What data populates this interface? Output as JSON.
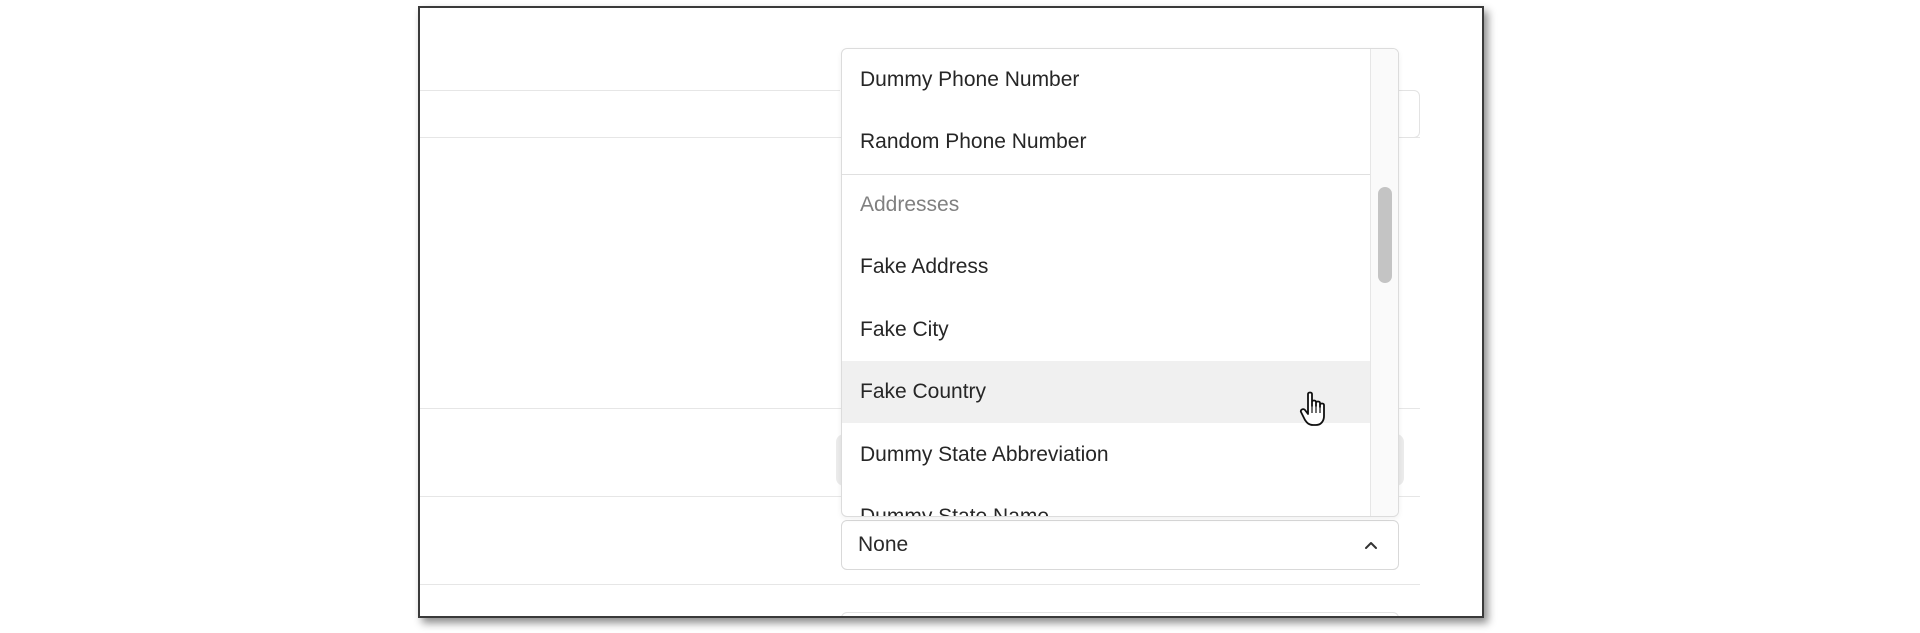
{
  "dropdown": {
    "items": [
      {
        "label": "Dummy Phone Number",
        "type": "option"
      },
      {
        "label": "Random Phone Number",
        "type": "option"
      },
      {
        "label": "Addresses",
        "type": "group-header"
      },
      {
        "label": "Fake Address",
        "type": "option"
      },
      {
        "label": "Fake City",
        "type": "option"
      },
      {
        "label": "Fake Country",
        "type": "option",
        "hovered": true
      },
      {
        "label": "Dummy State Abbreviation",
        "type": "option"
      },
      {
        "label": "Dummy State Name",
        "type": "option"
      }
    ]
  },
  "select": {
    "value": "None",
    "icon": "chevron-up-icon"
  },
  "colors": {
    "hover_bg": "#f0f0f0",
    "group_header_text": "#808080",
    "option_text": "#262626",
    "scroll_thumb": "#c4c4c4"
  },
  "cursor": {
    "icon": "hand-pointer-icon"
  }
}
